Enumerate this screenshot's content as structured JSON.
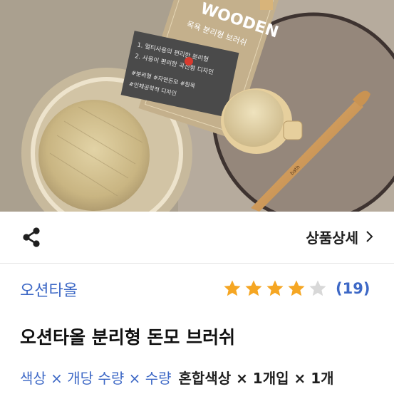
{
  "product_image": {
    "package_brand": "WOODEN",
    "package_subtitle": "목욕 분리형 브러쉬",
    "package_lines": [
      "1. 멀티사용의 편리한 분리형",
      "2. 사용이 편리한 곡선형 디자인"
    ],
    "package_features": [
      "#분리형 #자연돈모 #원목",
      "#인체공학적 디자인"
    ],
    "handle_stamp": "bath"
  },
  "actions": {
    "share_icon": "share-icon",
    "detail_label": "상품상세",
    "detail_icon": "chevron-right-icon"
  },
  "shop": {
    "name": "오션타올"
  },
  "rating": {
    "stars": 4,
    "max_stars": 5,
    "review_count": "(19)",
    "colors": {
      "filled": "#f5a623",
      "empty": "#d8d8d8"
    }
  },
  "product": {
    "title": "오션타올 분리형 돈모 브러쉬"
  },
  "options": {
    "label": "색상 × 개당 수량 × 수량",
    "value": "혼합색상 × 1개입 × 1개"
  },
  "colors": {
    "accent": "#3d68c6",
    "text": "#111111"
  }
}
